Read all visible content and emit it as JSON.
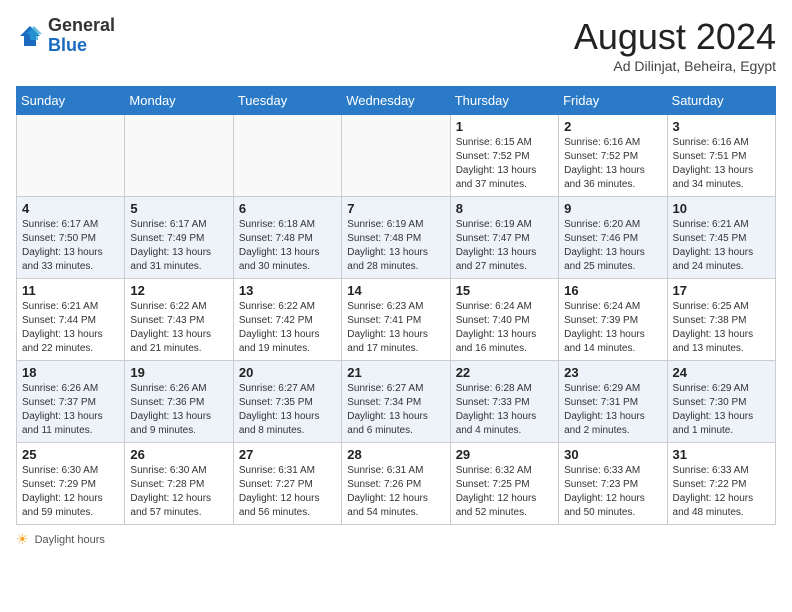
{
  "header": {
    "logo_general": "General",
    "logo_blue": "Blue",
    "month_year": "August 2024",
    "location": "Ad Dilinjat, Beheira, Egypt"
  },
  "days_of_week": [
    "Sunday",
    "Monday",
    "Tuesday",
    "Wednesday",
    "Thursday",
    "Friday",
    "Saturday"
  ],
  "footer": {
    "label": "Daylight hours"
  },
  "weeks": [
    {
      "days": [
        {
          "date": "",
          "detail": ""
        },
        {
          "date": "",
          "detail": ""
        },
        {
          "date": "",
          "detail": ""
        },
        {
          "date": "",
          "detail": ""
        },
        {
          "date": "1",
          "detail": "Sunrise: 6:15 AM\nSunset: 7:52 PM\nDaylight: 13 hours\nand 37 minutes."
        },
        {
          "date": "2",
          "detail": "Sunrise: 6:16 AM\nSunset: 7:52 PM\nDaylight: 13 hours\nand 36 minutes."
        },
        {
          "date": "3",
          "detail": "Sunrise: 6:16 AM\nSunset: 7:51 PM\nDaylight: 13 hours\nand 34 minutes."
        }
      ]
    },
    {
      "days": [
        {
          "date": "4",
          "detail": "Sunrise: 6:17 AM\nSunset: 7:50 PM\nDaylight: 13 hours\nand 33 minutes."
        },
        {
          "date": "5",
          "detail": "Sunrise: 6:17 AM\nSunset: 7:49 PM\nDaylight: 13 hours\nand 31 minutes."
        },
        {
          "date": "6",
          "detail": "Sunrise: 6:18 AM\nSunset: 7:48 PM\nDaylight: 13 hours\nand 30 minutes."
        },
        {
          "date": "7",
          "detail": "Sunrise: 6:19 AM\nSunset: 7:48 PM\nDaylight: 13 hours\nand 28 minutes."
        },
        {
          "date": "8",
          "detail": "Sunrise: 6:19 AM\nSunset: 7:47 PM\nDaylight: 13 hours\nand 27 minutes."
        },
        {
          "date": "9",
          "detail": "Sunrise: 6:20 AM\nSunset: 7:46 PM\nDaylight: 13 hours\nand 25 minutes."
        },
        {
          "date": "10",
          "detail": "Sunrise: 6:21 AM\nSunset: 7:45 PM\nDaylight: 13 hours\nand 24 minutes."
        }
      ]
    },
    {
      "days": [
        {
          "date": "11",
          "detail": "Sunrise: 6:21 AM\nSunset: 7:44 PM\nDaylight: 13 hours\nand 22 minutes."
        },
        {
          "date": "12",
          "detail": "Sunrise: 6:22 AM\nSunset: 7:43 PM\nDaylight: 13 hours\nand 21 minutes."
        },
        {
          "date": "13",
          "detail": "Sunrise: 6:22 AM\nSunset: 7:42 PM\nDaylight: 13 hours\nand 19 minutes."
        },
        {
          "date": "14",
          "detail": "Sunrise: 6:23 AM\nSunset: 7:41 PM\nDaylight: 13 hours\nand 17 minutes."
        },
        {
          "date": "15",
          "detail": "Sunrise: 6:24 AM\nSunset: 7:40 PM\nDaylight: 13 hours\nand 16 minutes."
        },
        {
          "date": "16",
          "detail": "Sunrise: 6:24 AM\nSunset: 7:39 PM\nDaylight: 13 hours\nand 14 minutes."
        },
        {
          "date": "17",
          "detail": "Sunrise: 6:25 AM\nSunset: 7:38 PM\nDaylight: 13 hours\nand 13 minutes."
        }
      ]
    },
    {
      "days": [
        {
          "date": "18",
          "detail": "Sunrise: 6:26 AM\nSunset: 7:37 PM\nDaylight: 13 hours\nand 11 minutes."
        },
        {
          "date": "19",
          "detail": "Sunrise: 6:26 AM\nSunset: 7:36 PM\nDaylight: 13 hours\nand 9 minutes."
        },
        {
          "date": "20",
          "detail": "Sunrise: 6:27 AM\nSunset: 7:35 PM\nDaylight: 13 hours\nand 8 minutes."
        },
        {
          "date": "21",
          "detail": "Sunrise: 6:27 AM\nSunset: 7:34 PM\nDaylight: 13 hours\nand 6 minutes."
        },
        {
          "date": "22",
          "detail": "Sunrise: 6:28 AM\nSunset: 7:33 PM\nDaylight: 13 hours\nand 4 minutes."
        },
        {
          "date": "23",
          "detail": "Sunrise: 6:29 AM\nSunset: 7:31 PM\nDaylight: 13 hours\nand 2 minutes."
        },
        {
          "date": "24",
          "detail": "Sunrise: 6:29 AM\nSunset: 7:30 PM\nDaylight: 13 hours\nand 1 minute."
        }
      ]
    },
    {
      "days": [
        {
          "date": "25",
          "detail": "Sunrise: 6:30 AM\nSunset: 7:29 PM\nDaylight: 12 hours\nand 59 minutes."
        },
        {
          "date": "26",
          "detail": "Sunrise: 6:30 AM\nSunset: 7:28 PM\nDaylight: 12 hours\nand 57 minutes."
        },
        {
          "date": "27",
          "detail": "Sunrise: 6:31 AM\nSunset: 7:27 PM\nDaylight: 12 hours\nand 56 minutes."
        },
        {
          "date": "28",
          "detail": "Sunrise: 6:31 AM\nSunset: 7:26 PM\nDaylight: 12 hours\nand 54 minutes."
        },
        {
          "date": "29",
          "detail": "Sunrise: 6:32 AM\nSunset: 7:25 PM\nDaylight: 12 hours\nand 52 minutes."
        },
        {
          "date": "30",
          "detail": "Sunrise: 6:33 AM\nSunset: 7:23 PM\nDaylight: 12 hours\nand 50 minutes."
        },
        {
          "date": "31",
          "detail": "Sunrise: 6:33 AM\nSunset: 7:22 PM\nDaylight: 12 hours\nand 48 minutes."
        }
      ]
    }
  ]
}
